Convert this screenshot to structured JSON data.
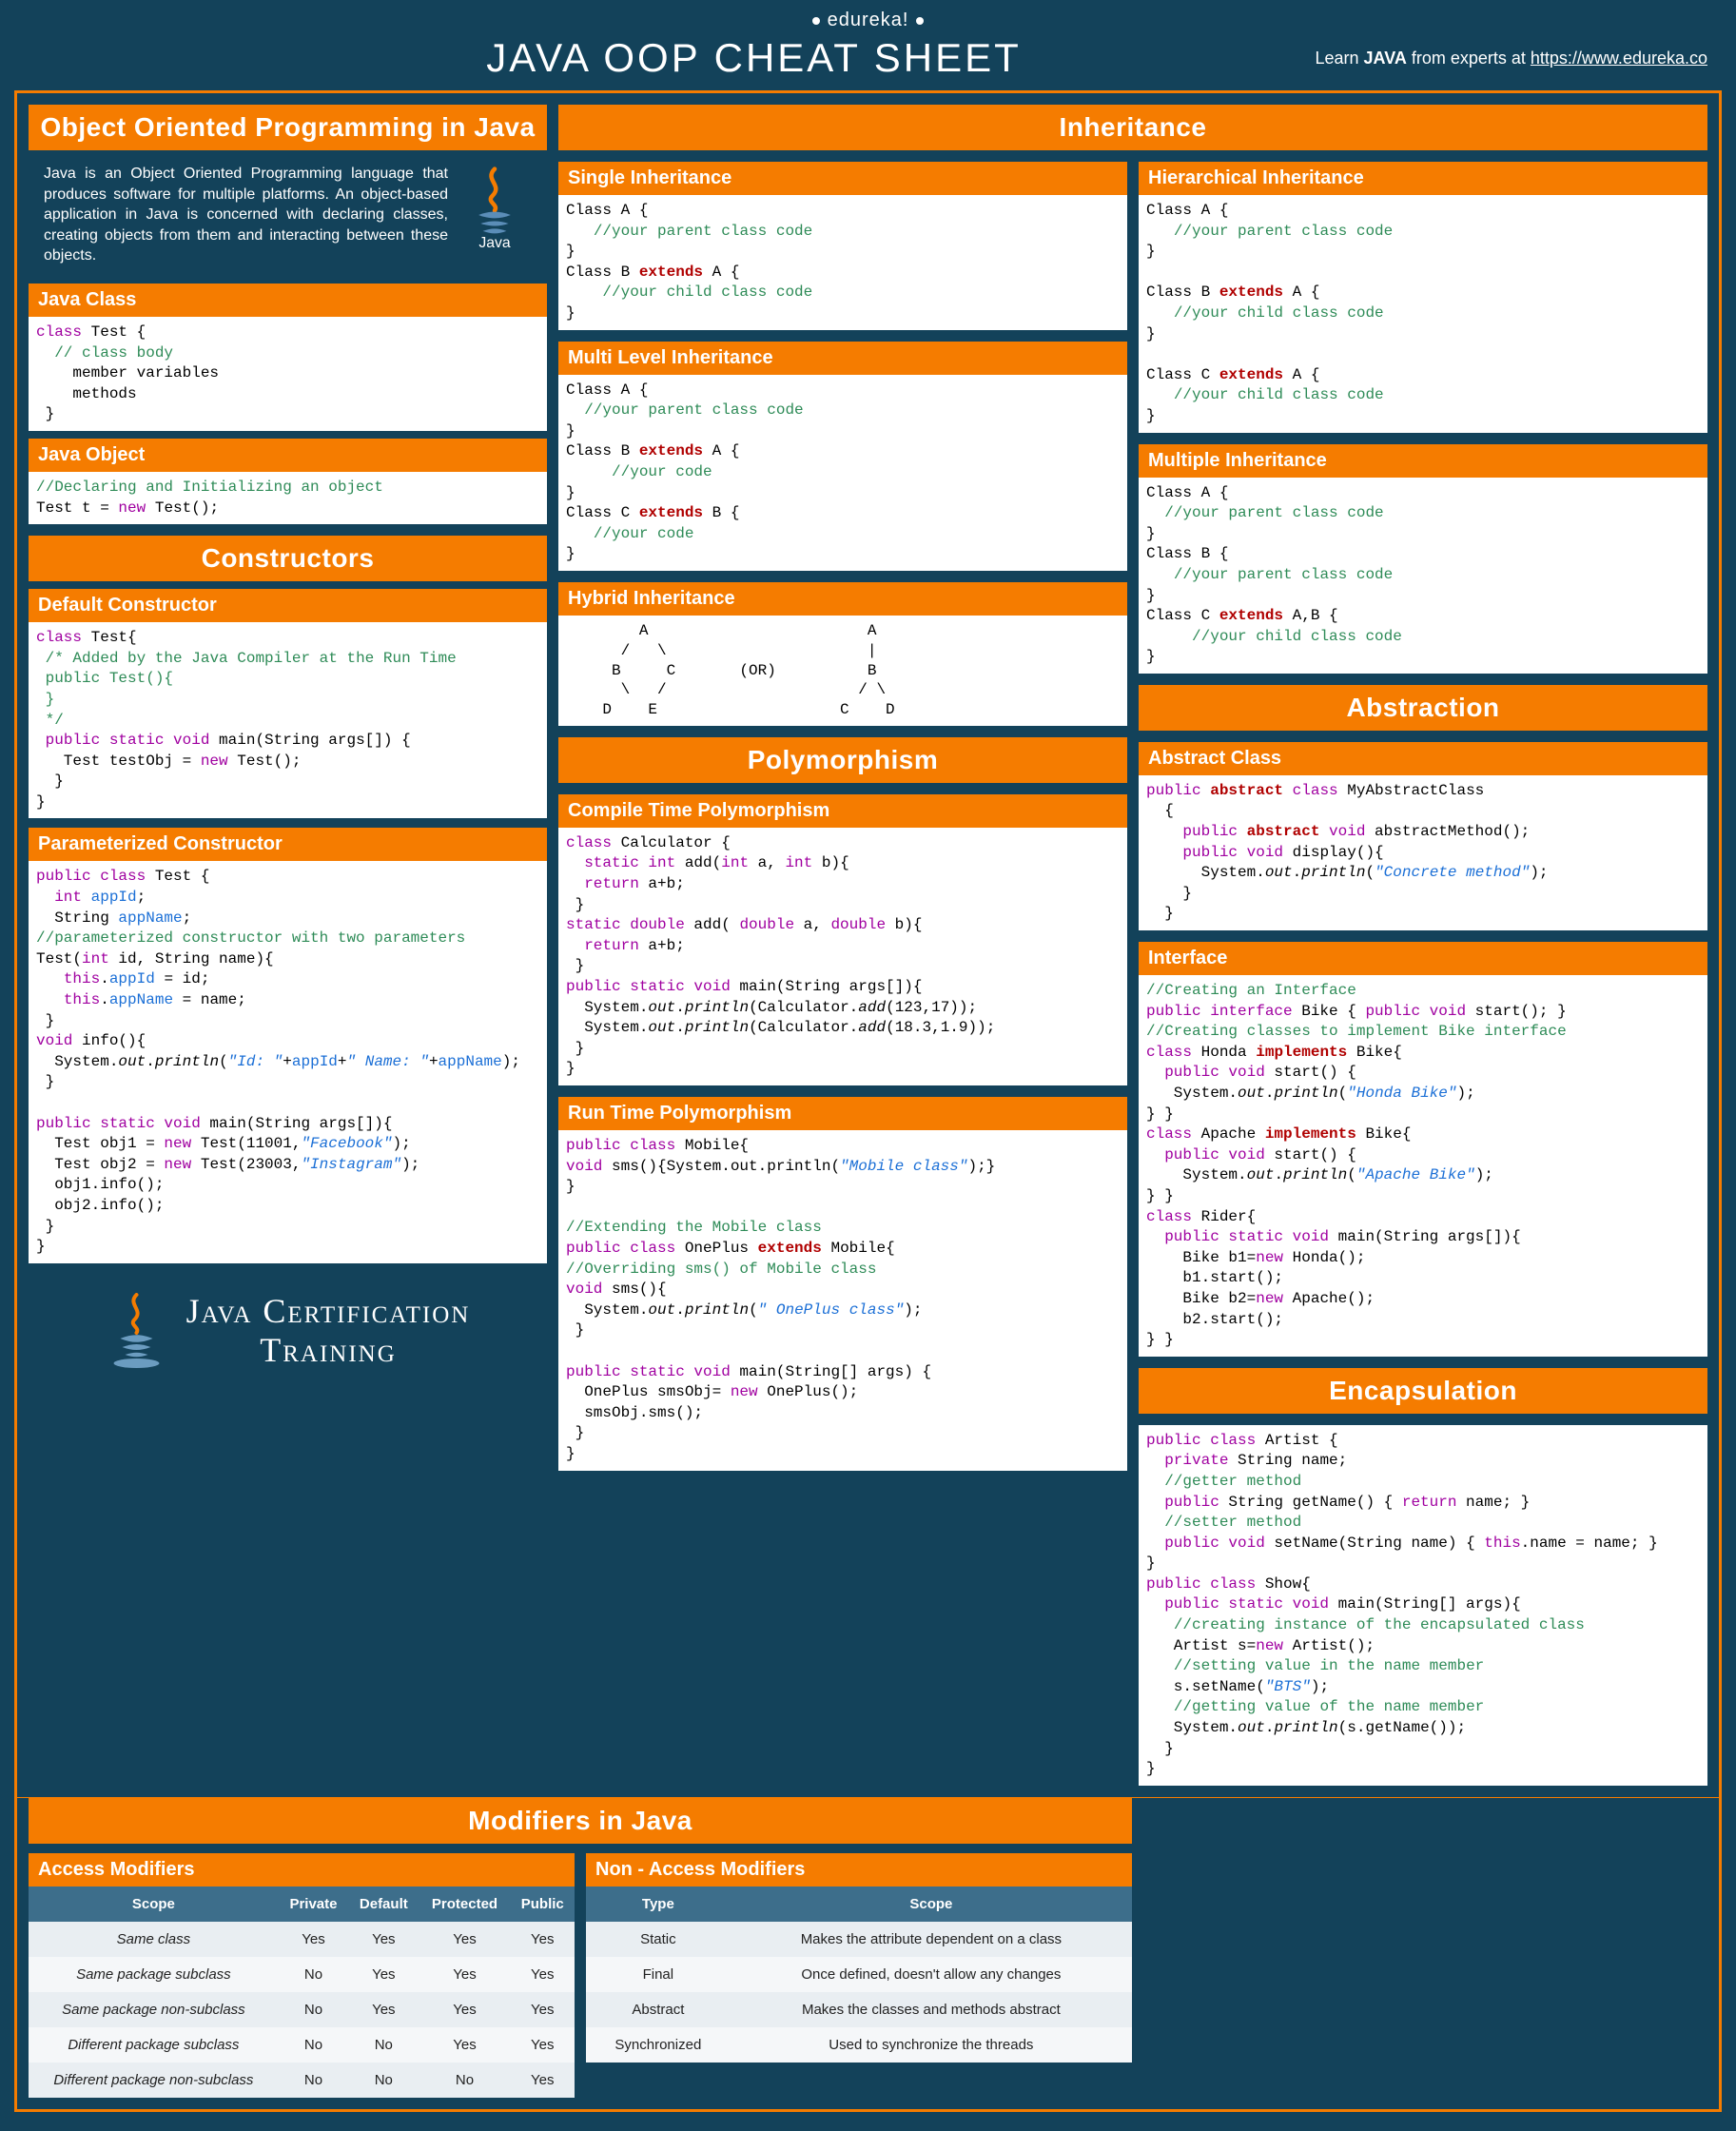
{
  "brand": "edureka!",
  "title": "JAVA OOP CHEAT SHEET",
  "learn_prefix": "Learn ",
  "learn_bold": "JAVA",
  "learn_mid": " from experts at ",
  "learn_link": "https://www.edureka.co",
  "colA": {
    "oop_title": "Object Oriented Programming in Java",
    "intro": "Java is an Object Oriented Programming language that produces software for multiple platforms. An object-based application in Java is concerned with declaring classes, creating objects from them and interacting between these objects.",
    "java_class_title": "Java Class",
    "java_object_title": "Java Object",
    "constructors_title": "Constructors",
    "default_ctor_title": "Default Constructor",
    "param_ctor_title": "Parameterized Constructor",
    "cert_line1": "Java Certification",
    "cert_line2": "Training",
    "modifiers_title": "Modifiers in Java",
    "access_mod_title": "Access Modifiers",
    "non_access_title": "Non - Access Modifiers",
    "access_table": {
      "headers": [
        "Scope",
        "Private",
        "Default",
        "Protected",
        "Public"
      ],
      "rows": [
        [
          "Same class",
          "Yes",
          "Yes",
          "Yes",
          "Yes"
        ],
        [
          "Same package subclass",
          "No",
          "Yes",
          "Yes",
          "Yes"
        ],
        [
          "Same package non-subclass",
          "No",
          "Yes",
          "Yes",
          "Yes"
        ],
        [
          "Different package subclass",
          "No",
          "No",
          "Yes",
          "Yes"
        ],
        [
          "Different package non-subclass",
          "No",
          "No",
          "No",
          "Yes"
        ]
      ]
    },
    "non_access_table": {
      "headers": [
        "Type",
        "Scope"
      ],
      "rows": [
        [
          "Static",
          "Makes the attribute dependent on a class"
        ],
        [
          "Final",
          "Once defined, doesn't allow any changes"
        ],
        [
          "Abstract",
          "Makes the classes and methods abstract"
        ],
        [
          "Synchronized",
          "Used to synchronize  the threads"
        ]
      ]
    }
  },
  "inh": {
    "title": "Inheritance",
    "single": "Single Inheritance",
    "multi": "Multi Level Inheritance",
    "hybrid": "Hybrid Inheritance",
    "hier": "Hierarchical Inheritance",
    "multiple": "Multiple Inheritance",
    "hybrid_diagram": "        A                        A\n      /   \\                      |\n     B     C       (OR)          B\n      \\   /                     / \\\n    D    E                    C    D"
  },
  "poly": {
    "title": "Polymorphism",
    "compile": "Compile Time Polymorphism",
    "runtime": "Run Time Polymorphism"
  },
  "abs": {
    "title": "Abstraction",
    "absclass": "Abstract Class",
    "iface": "Interface"
  },
  "enc": {
    "title": "Encapsulation"
  },
  "code": {
    "java_class": "class Test {\n  // class body\n    member variables\n    methods\n }",
    "java_object": "//Declaring and Initializing an object\nTest t = new Test();",
    "default_ctor": "class Test{\n /* Added by the Java Compiler at the Run Time\n public Test(){\n }\n */\n public static void main(String args[]) {\n   Test testObj = new Test();\n  }\n}",
    "param_ctor": "public class Test {\n  int appId;\n  String appName;\n//parameterized constructor with two parameters\nTest(int id, String name){\n   this.appId = id;\n   this.appName = name;\n }\nvoid info(){\n  System.out.println(\"Id: \"+appId+\" Name: \"+appName);\n }\n\npublic static void main(String args[]){\n  Test obj1 = new Test(11001,\"Facebook\");\n  Test obj2 = new Test(23003,\"Instagram\");\n  obj1.info();\n  obj2.info();\n }\n}",
    "single": "Class A {\n   //your parent class code\n}\nClass B extends A {\n    //your child class code\n}",
    "multilevel": "Class A {\n  //your parent class code\n}\nClass B extends A {\n     //your code\n}\nClass C extends B {\n   //your code\n}",
    "hier": "Class A {\n   //your parent class code\n}\n\nClass B extends A {\n   //your child class code\n}\n\nClass C extends A {\n   //your child class code\n}",
    "multiple": "Class A {\n  //your parent class code\n}\nClass B {\n   //your parent class code\n}\nClass C extends A,B {\n     //your child class code\n}",
    "compile": "class Calculator {\n  static int add(int a, int b){\n  return a+b;\n }\nstatic double add( double a, double b){\n  return a+b;\n }\npublic static void main(String args[]){\n  System.out.println(Calculator.add(123,17));\n  System.out.println(Calculator.add(18.3,1.9));\n }\n}",
    "runtime": "public class Mobile{\nvoid sms(){System.out.println(\"Mobile class\");}\n}\n\n//Extending the Mobile class\npublic class OnePlus extends Mobile{\n//Overriding sms() of Mobile class\nvoid sms(){\n  System.out.println(\" OnePlus class\");\n }\n\npublic static void main(String[] args) {\n  OnePlus smsObj= new OnePlus();\n  smsObj.sms();\n }\n}",
    "absclass": "public abstract class MyAbstractClass\n  {\n    public abstract void abstractMethod();\n    public void display(){\n      System.out.println(\"Concrete method\");\n    }\n  }",
    "iface": "//Creating an Interface\npublic interface Bike { public void start(); }\n//Creating classes to implement Bike interface\nclass Honda implements Bike{\n  public void start() {\n   System.out.println(\"Honda Bike\");\n} }\nclass Apache implements Bike{\n  public void start() {\n    System.out.println(\"Apache Bike\");\n} }\nclass Rider{\n  public static void main(String args[]){\n    Bike b1=new Honda();\n    b1.start();\n    Bike b2=new Apache();\n    b2.start();\n} }",
    "encap": "public class Artist {\n  private String name;\n  //getter method\n  public String getName() { return name; }\n  //setter method\n  public void setName(String name) { this.name = name; }\n}\npublic class Show{\n  public static void main(String[] args){\n   //creating instance of the encapsulated class\n   Artist s=new Artist();\n   //setting value in the name member\n   s.setName(\"BTS\");\n   //getting value of the name member\n   System.out.println(s.getName());\n  }\n}"
  }
}
